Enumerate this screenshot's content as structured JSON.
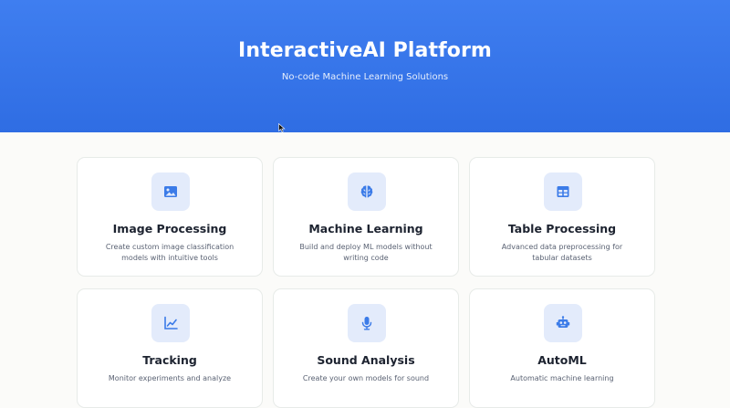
{
  "hero": {
    "title": "InteractiveAI Platform",
    "subtitle": "No-code Machine Learning Solutions"
  },
  "colors": {
    "accent": "#2f6de3",
    "icon_bg": "#e3ebfb",
    "icon_fg": "#3b7be8"
  },
  "cards": [
    {
      "icon": "image-icon",
      "title": "Image Processing",
      "description": "Create custom image classification models with intuitive tools"
    },
    {
      "icon": "brain-icon",
      "title": "Machine Learning",
      "description": "Build and deploy ML models without writing code"
    },
    {
      "icon": "table-icon",
      "title": "Table Processing",
      "description": "Advanced data preprocessing for tabular datasets"
    },
    {
      "icon": "chart-line-icon",
      "title": "Tracking",
      "description": "Monitor experiments and analyze"
    },
    {
      "icon": "microphone-icon",
      "title": "Sound Analysis",
      "description": "Create your own models for sound"
    },
    {
      "icon": "robot-icon",
      "title": "AutoML",
      "description": "Automatic machine learning"
    }
  ]
}
